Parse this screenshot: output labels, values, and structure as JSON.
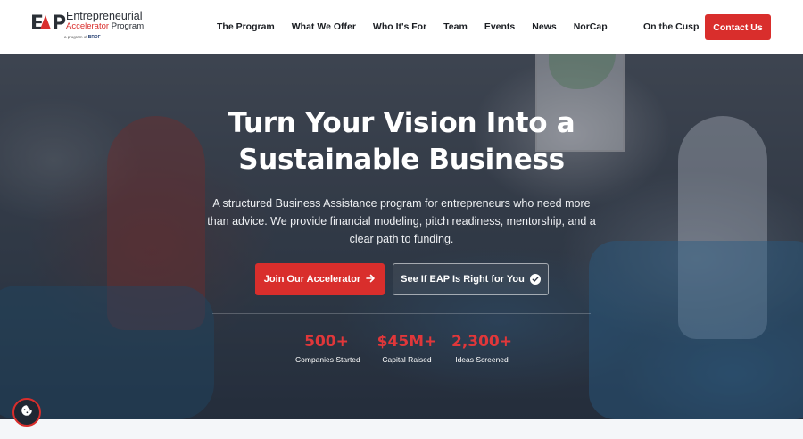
{
  "logo": {
    "mark": "EAP",
    "line1": "Entrepreneurial",
    "line2_accent": "Accelerator",
    "line2_rest": "Program",
    "sub": "a program of",
    "sub_brand": "BRDF"
  },
  "nav": {
    "items": [
      "The Program",
      "What We Offer",
      "Who It's For",
      "Team",
      "Events",
      "News",
      "NorCap"
    ],
    "cusp": "On the Cusp",
    "contact": "Contact Us"
  },
  "hero": {
    "title_line1": "Turn Your Vision Into a",
    "title_line2": "Sustainable Business",
    "description": "A structured Business Assistance program for entrepreneurs who need more than advice. We provide financial modeling, pitch readiness, mentorship, and a clear path to funding.",
    "primary_button": "Join Our Accelerator",
    "secondary_button": "See If EAP Is Right for You",
    "stats": [
      {
        "value": "500+",
        "label": "Companies Started"
      },
      {
        "value": "$45M+",
        "label": "Capital Raised"
      },
      {
        "value": "2,300+",
        "label": "Ideas Screened"
      }
    ]
  },
  "icons": {
    "join_arrow": "arrow-right-icon",
    "see_check": "check-circle-icon",
    "cookie": "cookie-icon"
  },
  "colors": {
    "accent": "#d92e2c",
    "stat": "#e0373a",
    "text_dark": "#1b1e23"
  }
}
